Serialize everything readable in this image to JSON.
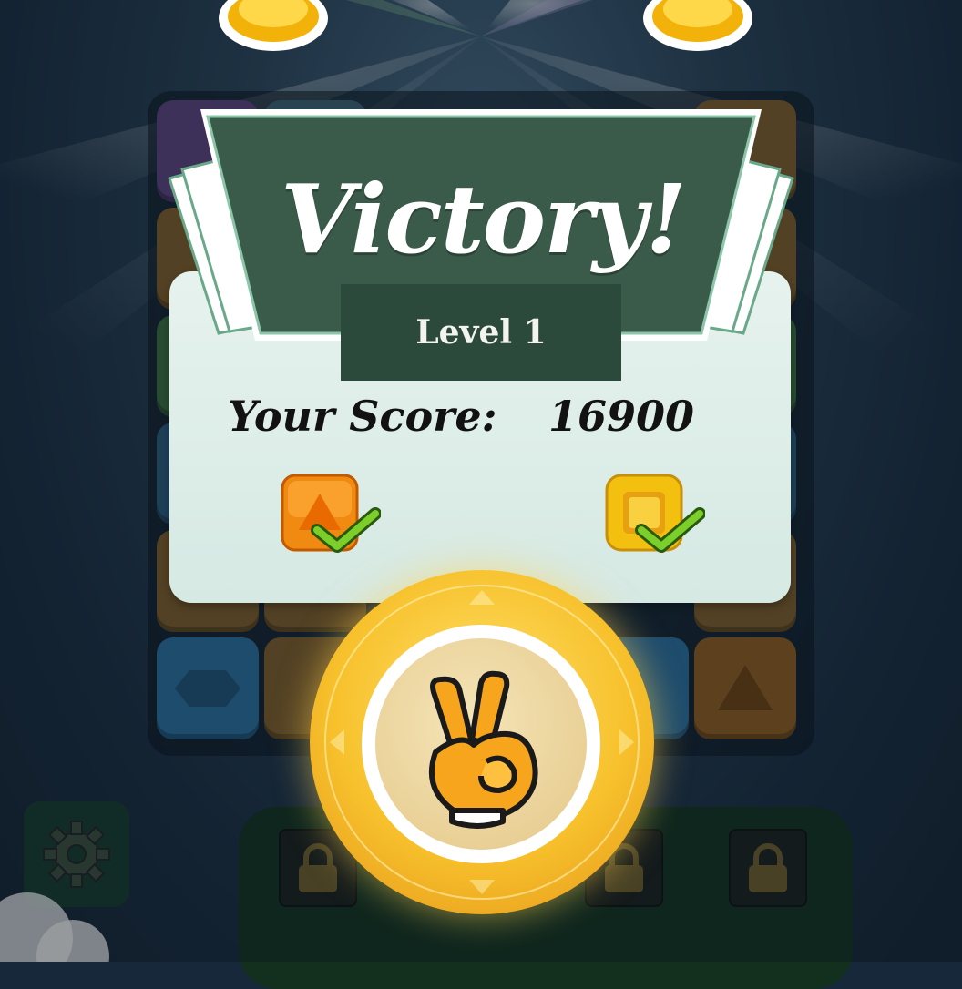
{
  "popup": {
    "title": "Victory!",
    "level_label": "Level 1",
    "score_label": "Your Score:",
    "score_value": "16900"
  },
  "goals": [
    {
      "icon": "orange-triangle-gem-icon",
      "status": "complete"
    },
    {
      "icon": "yellow-square-gem-icon",
      "status": "complete"
    }
  ],
  "continue_button": {
    "icon": "peace-hand-icon"
  },
  "locked_slots": 4,
  "colors": {
    "banner": "#3a5a49",
    "panel": "#e3f0eb",
    "button_gold": "#f7c12c",
    "check_green": "#6abf2a"
  }
}
